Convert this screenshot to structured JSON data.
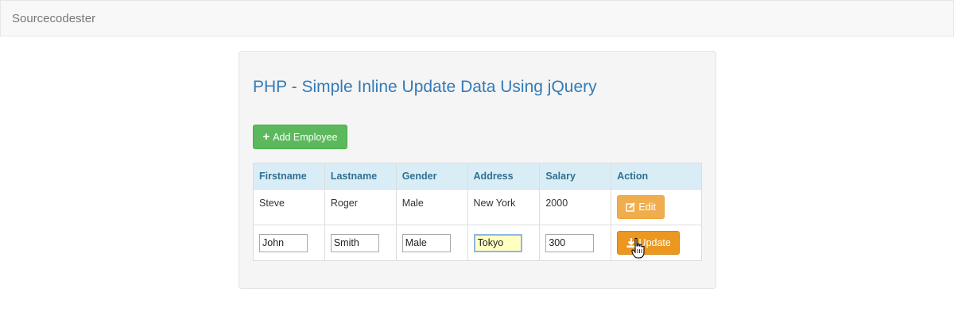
{
  "navbar": {
    "brand": "Sourcecodester"
  },
  "main": {
    "title": "PHP - Simple Inline Update Data Using jQuery",
    "add_button_label": "Add Employee"
  },
  "table": {
    "headers": [
      "Firstname",
      "Lastname",
      "Gender",
      "Address",
      "Salary",
      "Action"
    ],
    "row1": {
      "firstname": "Steve",
      "lastname": "Roger",
      "gender": "Male",
      "address": "New York",
      "salary": "2000",
      "action_label": "Edit"
    },
    "row2": {
      "firstname": "John",
      "lastname": "Smith",
      "gender": "Male",
      "address": "Tokyo",
      "salary": "300",
      "action_label": "Update"
    }
  },
  "colors": {
    "title": "#337ab7",
    "add_button": "#5cb85c",
    "edit_button": "#f0ad4e",
    "update_button": "#ec971f",
    "table_header": "#d9edf7",
    "focused_input": "#ffffc2"
  },
  "icons": {
    "add": "plus-icon",
    "edit": "edit-icon",
    "update": "download-icon",
    "cursor": "hand-pointer-icon"
  }
}
